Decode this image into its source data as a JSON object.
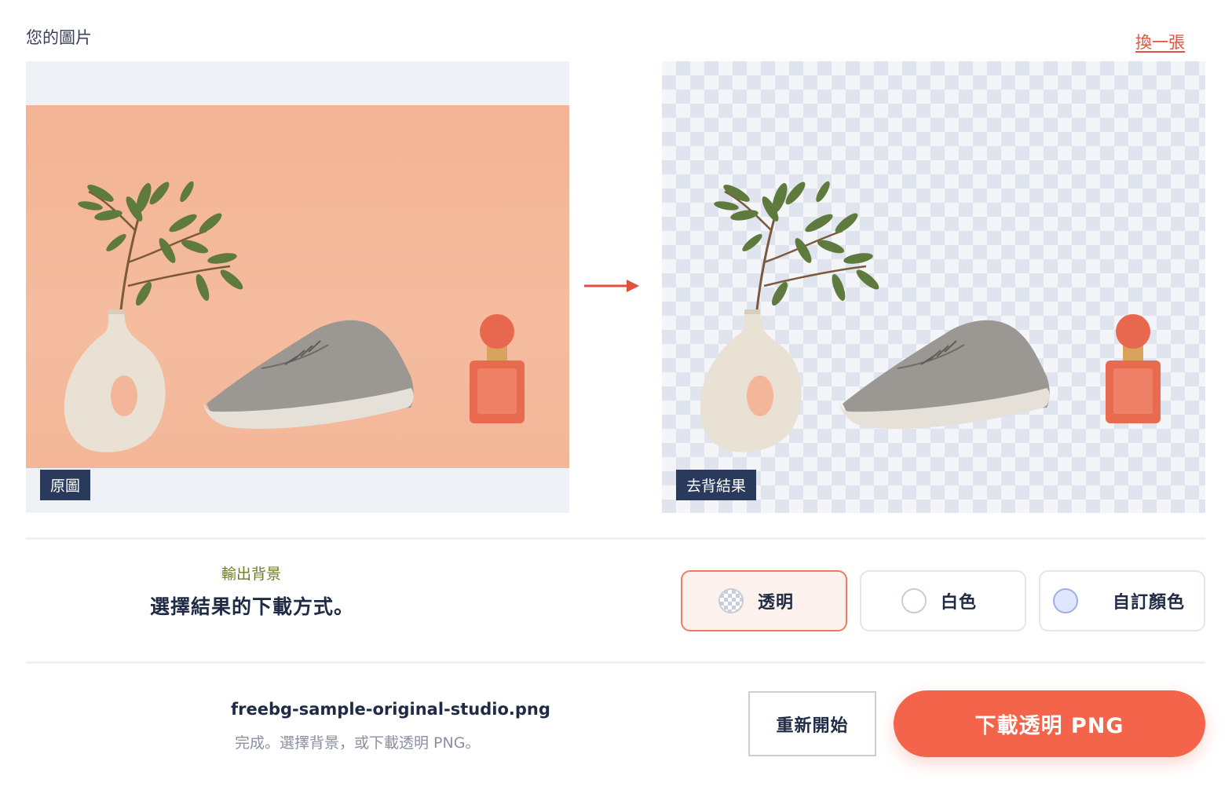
{
  "header": {
    "title": "您的圖片",
    "replace_link": "換一張"
  },
  "panels": {
    "original_tag": "原圖",
    "result_tag": "去背結果"
  },
  "output_background": {
    "eyebrow": "輸出背景",
    "title": "選擇結果的下載方式。",
    "options": [
      {
        "label": "透明",
        "selected": true,
        "icon": "checkerboard-swatch"
      },
      {
        "label": "白色",
        "selected": false,
        "icon": "white-swatch"
      },
      {
        "label": "自訂顏色",
        "selected": false,
        "icon": "custom-color-swatch"
      }
    ]
  },
  "footer": {
    "filename": "freebg-sample-original-studio.png",
    "status": "完成。選擇背景，或下載透明 PNG。",
    "restart_label": "重新開始",
    "download_label": "下載透明 PNG"
  },
  "colors": {
    "accent": "#f4644a",
    "tag_bg": "#2a3a5c",
    "eyebrow": "#6f7a2e",
    "photo_bg": "#f4b89a"
  }
}
